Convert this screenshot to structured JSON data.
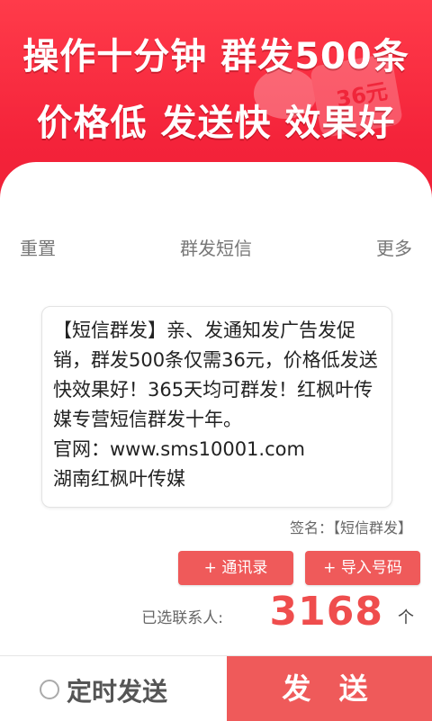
{
  "banner": {
    "line1": "操作十分钟  群发500条",
    "line2": "价格低  发送快  效果好",
    "deco_price": "36元"
  },
  "toolbar": {
    "reset": "重置",
    "title": "群发短信",
    "more": "更多"
  },
  "message": {
    "text": "【短信群发】亲、发通知发广告发促销，群发500条仅需36元，价格低发送快效果好！365天均可群发！红枫叶传媒专营短信群发十年。\n官网：www.sms10001.com\n湖南红枫叶传媒"
  },
  "signature": "签名：【短信群发】",
  "buttons": {
    "contacts": "+ 通讯录",
    "import": "+ 导入号码"
  },
  "selected": {
    "label": "已选联系人:",
    "count": "3168",
    "unit": "个"
  },
  "bottom": {
    "timed": "定时发送",
    "send": "发 送"
  },
  "colors": {
    "brand_red": "#ef5a5a",
    "banner_red": "#f4233a",
    "count_red": "#ef4d4d"
  }
}
